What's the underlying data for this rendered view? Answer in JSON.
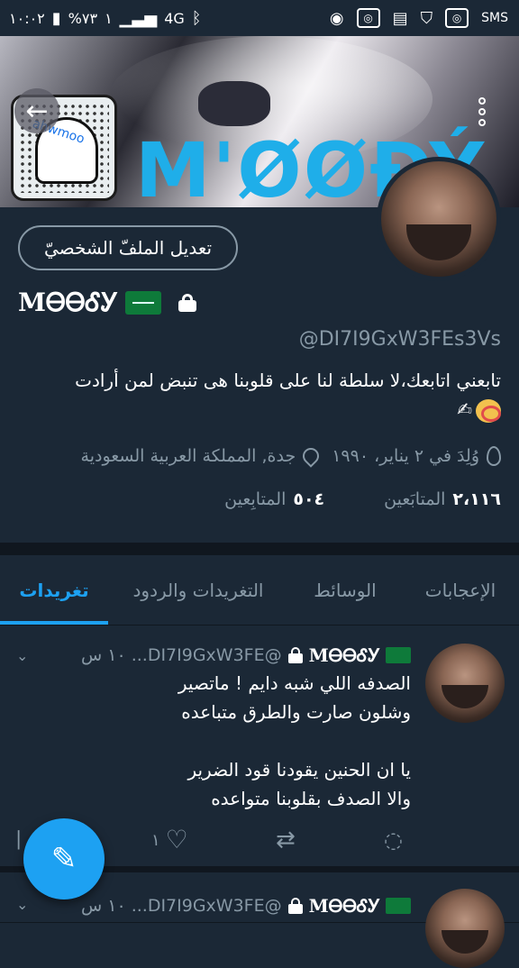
{
  "status_bar": {
    "time": "١٠:٠٢",
    "battery": "%٧٣",
    "signal": "١",
    "network": "4G",
    "sms": "SMS"
  },
  "banner": {
    "title": "M'ØØĐÝ",
    "snapcode_name": "ahwmoo"
  },
  "profile": {
    "edit_button": "تعديل الملفّ الشخصيّ",
    "name": "MᎾᎾᎴᎩ",
    "handle": "@DI7I9GxW3FEs3Vs",
    "bio": "تابعني اتابعك،لا سلطة لنا على قلوبنا  هى تنبض لمن أرادت",
    "birthday": "وُلِدَ في ٢ يناير، ١٩٩٠",
    "location": "جدة, المملكة العربية السعودية",
    "following_count": "٢،١١٦",
    "following_label": "المتابَعين",
    "followers_count": "٥٠٤",
    "followers_label": "المتابِعين"
  },
  "tabs": [
    "تغريدات",
    "التغريدات والردود",
    "الوسائط",
    "الإعجابات"
  ],
  "active_tab": 0,
  "tweets": [
    {
      "name": "MᎾᎾᎴᎩ",
      "handle": "@DI7I9GxW3FE...",
      "time": "١٠ س",
      "text": "الصدفه اللي شبه دايم ! ماتصير\nوشلون صارت والطرق متباعده\n\nيا ان الحنين يقودنا قود الضرير\nوالا الصدف بقلوبنا متواعده",
      "likes": "١"
    },
    {
      "name": "MᎾᎾᎴᎩ",
      "handle": "@DI7I9GxW3FE...",
      "time": "١٠ س"
    }
  ],
  "colors": {
    "background": "#1b2836",
    "accent": "#1da1f2",
    "muted": "#8899a6"
  }
}
